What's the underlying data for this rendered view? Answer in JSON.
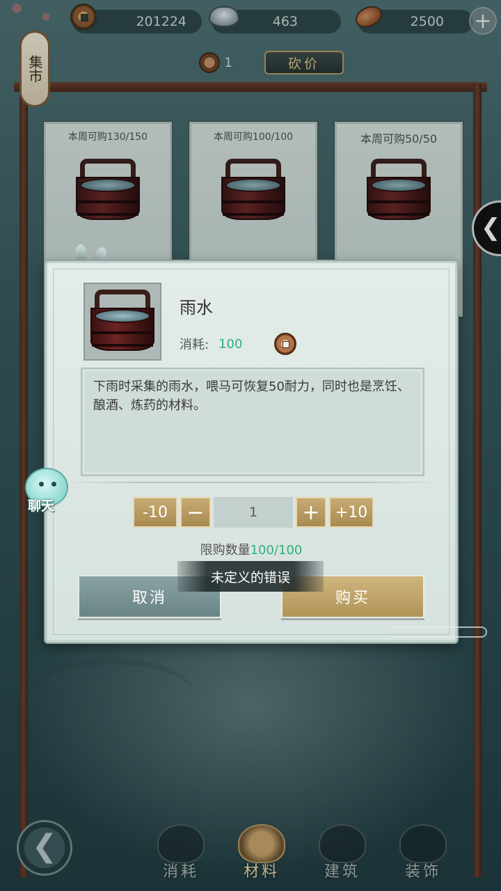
{
  "currency": {
    "copper": "201224",
    "silver": "463",
    "bean": "2500",
    "add_label": "+"
  },
  "market_sign": "集市",
  "refresh": {
    "count": "1",
    "bargain_label": "砍价"
  },
  "shelf": [
    {
      "limit": "本周可购130/150"
    },
    {
      "limit": "本周可购100/100"
    },
    {
      "limit": "本周可购50/50"
    }
  ],
  "side_arrow": "❮",
  "chat": {
    "label": "聊天"
  },
  "popup": {
    "item_name": "雨水",
    "cost_label": "消耗:",
    "cost_value": "100",
    "description": "下雨时采集的雨水，喂马可恢复50耐力，同时也是烹饪、酿酒、炼药的材料。",
    "qty": {
      "minus10": "-10",
      "minus": "−",
      "value": "1",
      "plus": "+",
      "plus10": "+10"
    },
    "limit_label": "限购数量",
    "limit_value": "100/100",
    "cancel_label": "取消",
    "buy_label": "购买"
  },
  "toast": "未定义的错误",
  "nav": {
    "back": "❮",
    "tabs": [
      {
        "label": "消耗",
        "icon": "bowl-icon",
        "active": false
      },
      {
        "label": "材料",
        "icon": "materials-icon",
        "active": true
      },
      {
        "label": "建筑",
        "icon": "building-icon",
        "active": false
      },
      {
        "label": "装饰",
        "icon": "decoration-icon",
        "active": false
      }
    ]
  }
}
